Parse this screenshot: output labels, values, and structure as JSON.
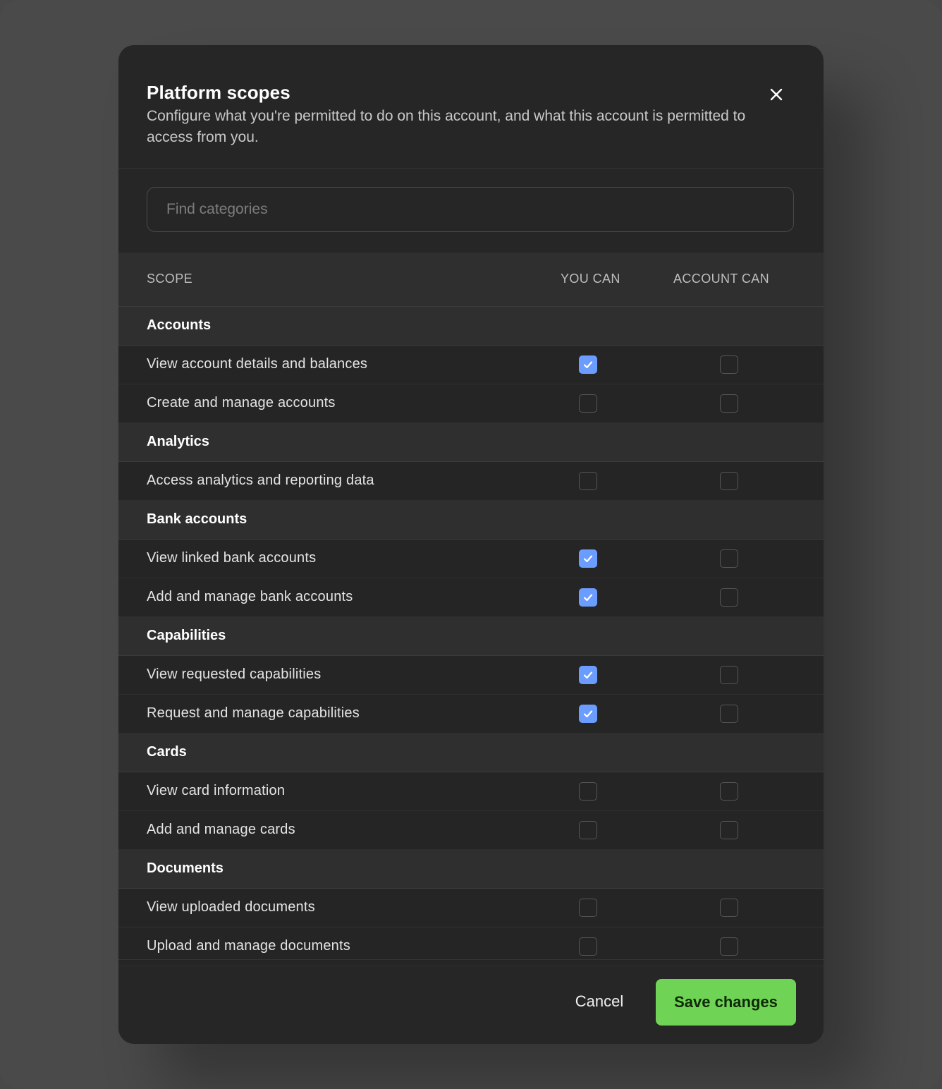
{
  "dialog": {
    "title": "Platform scopes",
    "subtitle": "Configure what you're permitted to do on this account, and what this account is permitted to access from you.",
    "close_icon": "close-icon"
  },
  "search": {
    "placeholder": "Find categories",
    "value": ""
  },
  "table": {
    "headers": {
      "scope": "SCOPE",
      "you_can": "YOU CAN",
      "account_can": "ACCOUNT CAN"
    },
    "groups": [
      {
        "label": "Accounts",
        "rows": [
          {
            "label": "View account details and balances",
            "you_can": true,
            "account_can": false
          },
          {
            "label": "Create and manage accounts",
            "you_can": false,
            "account_can": false
          }
        ]
      },
      {
        "label": "Analytics",
        "rows": [
          {
            "label": "Access analytics and reporting data",
            "you_can": false,
            "account_can": false
          }
        ]
      },
      {
        "label": "Bank accounts",
        "rows": [
          {
            "label": "View linked bank accounts",
            "you_can": true,
            "account_can": false
          },
          {
            "label": "Add and manage bank accounts",
            "you_can": true,
            "account_can": false
          }
        ]
      },
      {
        "label": "Capabilities",
        "rows": [
          {
            "label": "View requested capabilities",
            "you_can": true,
            "account_can": false
          },
          {
            "label": "Request and manage capabilities",
            "you_can": true,
            "account_can": false
          }
        ]
      },
      {
        "label": "Cards",
        "rows": [
          {
            "label": "View card information",
            "you_can": false,
            "account_can": false
          },
          {
            "label": "Add and manage cards",
            "you_can": false,
            "account_can": false
          }
        ]
      },
      {
        "label": "Documents",
        "rows": [
          {
            "label": "View uploaded documents",
            "you_can": false,
            "account_can": false
          },
          {
            "label": "Upload and manage documents",
            "you_can": false,
            "account_can": false
          }
        ]
      }
    ]
  },
  "footer": {
    "cancel_label": "Cancel",
    "save_label": "Save changes"
  },
  "colors": {
    "accent_check": "#6b9cff",
    "save_button": "#6fd455",
    "dialog_bg": "#262626"
  }
}
